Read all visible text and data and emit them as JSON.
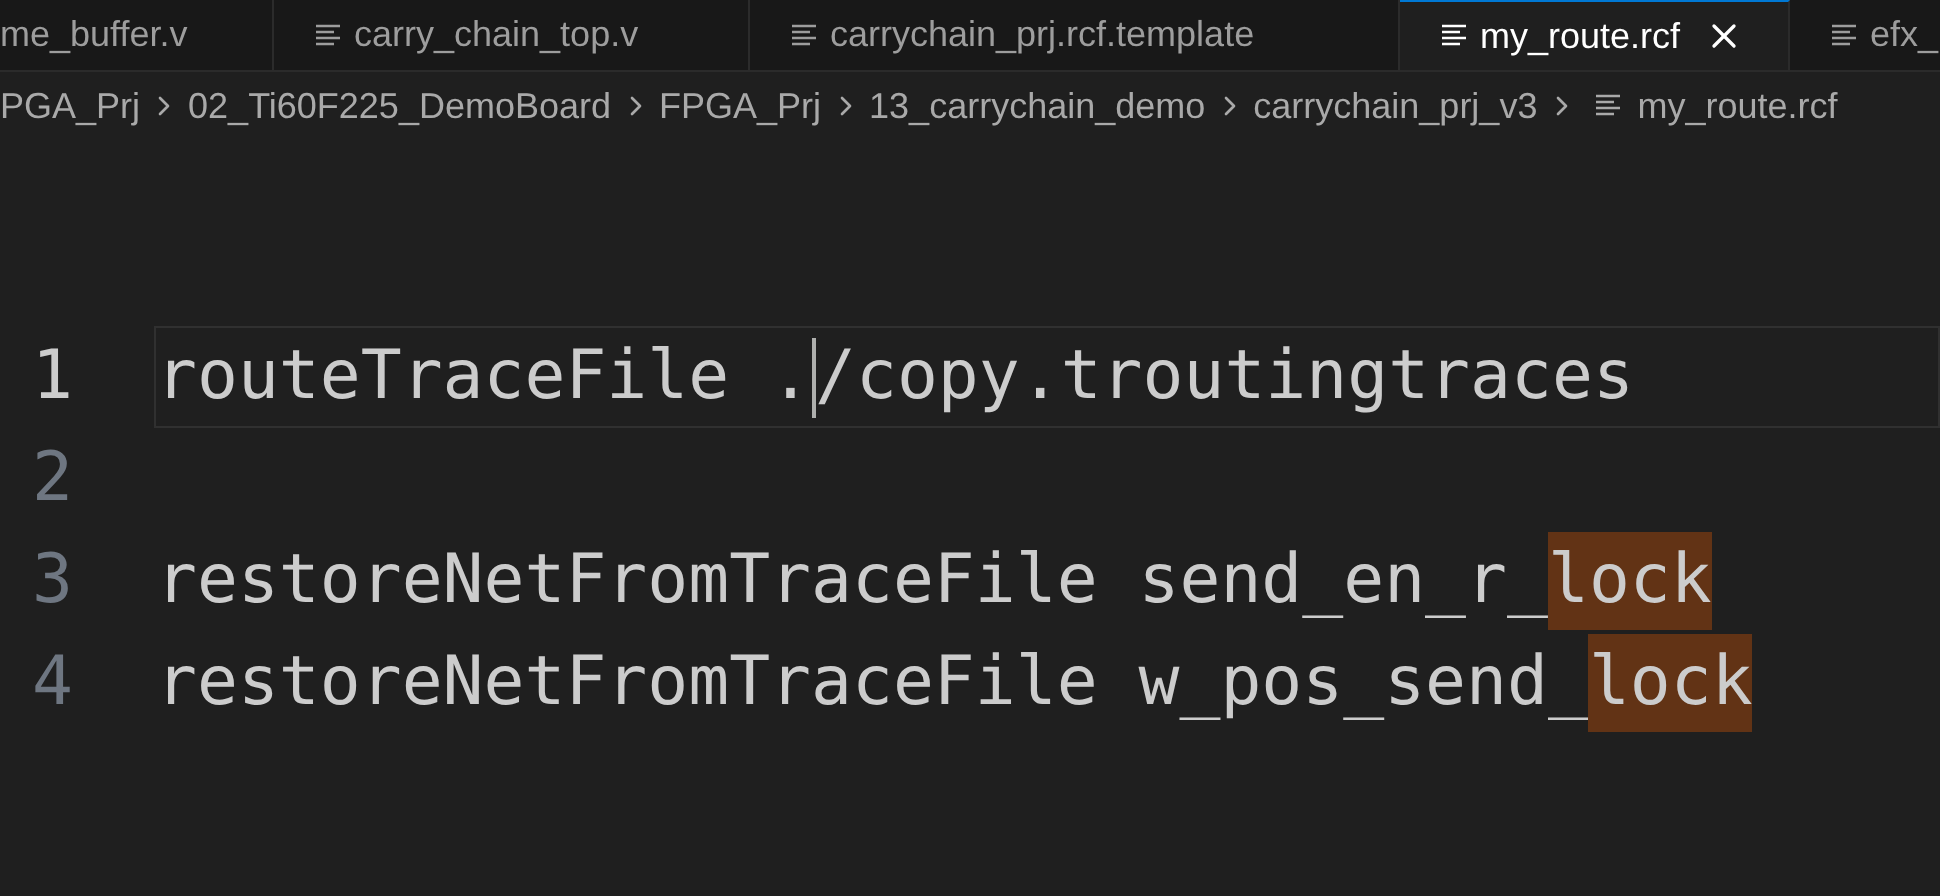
{
  "tabs": [
    {
      "label": "me_buffer.v",
      "icon_visible": false,
      "selected": false
    },
    {
      "label": "carry_chain_top.v",
      "icon_visible": true,
      "selected": false
    },
    {
      "label": "carrychain_prj.rcf.template",
      "icon_visible": true,
      "selected": false
    },
    {
      "label": "my_route.rcf",
      "icon_visible": true,
      "selected": true
    },
    {
      "label": "efx_",
      "icon_visible": true,
      "selected": false
    }
  ],
  "breadcrumb": [
    {
      "label": "PGA_Prj",
      "kind": "folder"
    },
    {
      "label": "02_Ti60F225_DemoBoard",
      "kind": "folder"
    },
    {
      "label": "FPGA_Prj",
      "kind": "folder"
    },
    {
      "label": "13_carrychain_demo",
      "kind": "folder"
    },
    {
      "label": "carrychain_prj_v3",
      "kind": "folder"
    },
    {
      "label": "my_route.rcf",
      "kind": "file"
    }
  ],
  "editor": {
    "lines": [
      {
        "number": "1",
        "current": true,
        "segments": [
          {
            "text": "routeTraceFile .",
            "highlight": false,
            "caret_before": false
          },
          {
            "text": "/copy.troutingtraces",
            "highlight": false,
            "caret_before": true
          }
        ]
      },
      {
        "number": "2",
        "current": false
      },
      {
        "number": "3",
        "current": false,
        "segments": [
          {
            "text": "restoreNetFromTraceFile send_en_r_",
            "highlight": false,
            "caret_before": false
          },
          {
            "text": "lock",
            "highlight": true,
            "caret_before": false
          }
        ]
      },
      {
        "number": "4",
        "current": false,
        "segments": [
          {
            "text": "restoreNetFromTraceFile w_pos_send_",
            "highlight": false,
            "caret_before": false
          },
          {
            "text": "lock",
            "highlight": true,
            "caret_before": false
          }
        ]
      }
    ]
  }
}
